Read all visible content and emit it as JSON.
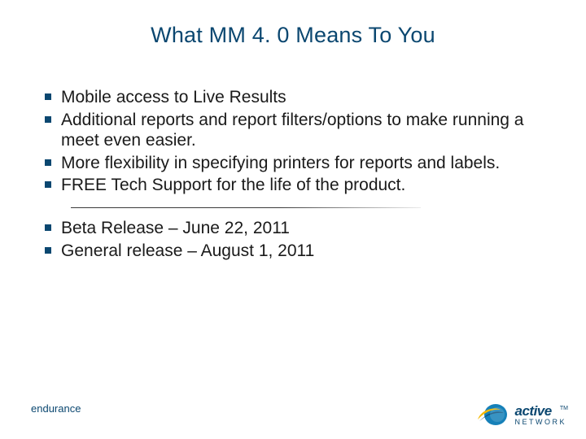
{
  "title": "What MM 4. 0 Means To You",
  "bullets_top": [
    "Mobile access to Live Results",
    "Additional reports and report filters/options to make running a meet even easier.",
    "More flexibility in specifying printers for reports and labels.",
    "FREE Tech Support for the life of the product."
  ],
  "bullets_bottom": [
    "Beta Release – June 22, 2011",
    "General release – August 1, 2011"
  ],
  "footer_text": "endurance",
  "logo": {
    "brand_top": "active",
    "brand_bottom": "NETWORK",
    "tm": "TM"
  },
  "colors": {
    "accent": "#0b4770",
    "swoosh_blue": "#1680b8",
    "swoosh_yellow": "#f5b800"
  }
}
